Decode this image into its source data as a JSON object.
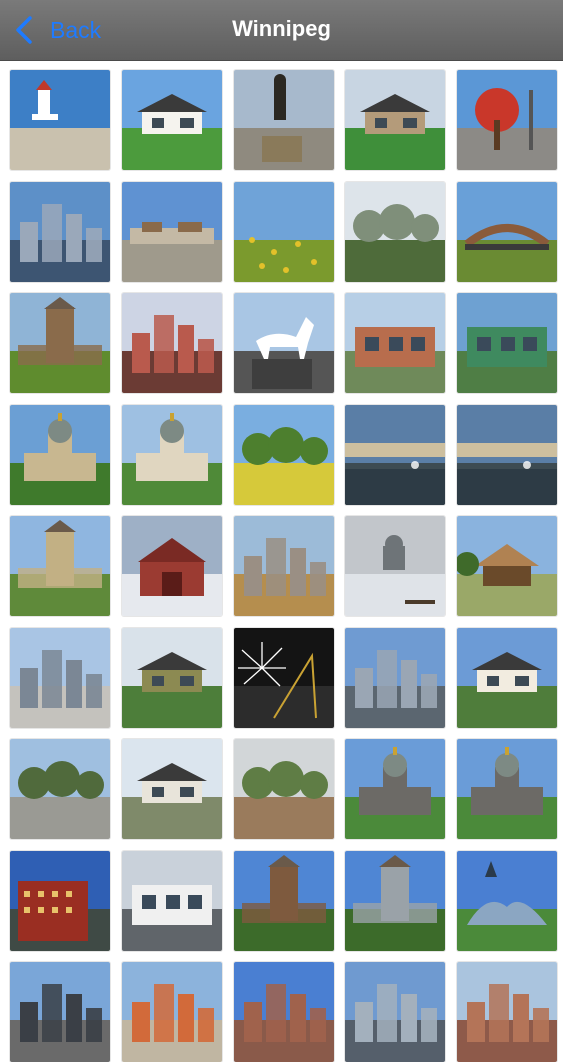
{
  "navbar": {
    "back_label": "Back",
    "title": "Winnipeg",
    "accent": "#1e7bff"
  },
  "gallery": {
    "columns": 5,
    "tiles": [
      {
        "sky": "#3d7fc6",
        "ground": "#c9c1ae",
        "accent": "#ffffff",
        "kind": "lighthouse"
      },
      {
        "sky": "#6aa4e0",
        "ground": "#4c9b3d",
        "accent": "#f5f3ee",
        "kind": "house"
      },
      {
        "sky": "#a7b9cc",
        "ground": "#8f8a7f",
        "accent": "#2b2822",
        "kind": "statue"
      },
      {
        "sky": "#c8d5e2",
        "ground": "#3f8f3a",
        "accent": "#b49b7a",
        "kind": "house"
      },
      {
        "sky": "#5b97d6",
        "ground": "#8c8a86",
        "accent": "#c9372a",
        "kind": "tree"
      },
      {
        "sky": "#5d90c8",
        "ground": "#3d5572",
        "accent": "#9aa8ba",
        "kind": "city"
      },
      {
        "sky": "#5f92d2",
        "ground": "#9f9a8c",
        "accent": "#c4b9a5",
        "kind": "plaza"
      },
      {
        "sky": "#6fa3d8",
        "ground": "#7b9a2d",
        "accent": "#e3c12a",
        "kind": "field"
      },
      {
        "sky": "#dde4ea",
        "ground": "#4e6b3a",
        "accent": "#7f8f7a",
        "kind": "park"
      },
      {
        "sky": "#69a0d8",
        "ground": "#6a8b33",
        "accent": "#8a5b3b",
        "kind": "bridge"
      },
      {
        "sky": "#8fb4d6",
        "ground": "#5f8c2e",
        "accent": "#8a6b4b",
        "kind": "castle"
      },
      {
        "sky": "#cdd4e4",
        "ground": "#6b3b34",
        "accent": "#b95a4d",
        "kind": "city"
      },
      {
        "sky": "#a9c6e4",
        "ground": "#555555",
        "accent": "#ffffff",
        "kind": "horse"
      },
      {
        "sky": "#b7cfe6",
        "ground": "#6f8a5a",
        "accent": "#b86d4d",
        "kind": "building"
      },
      {
        "sky": "#6ea1d2",
        "ground": "#4f7e45",
        "accent": "#3f8a5f",
        "kind": "building"
      },
      {
        "sky": "#6b9fd4",
        "ground": "#3f7a2c",
        "accent": "#c8b790",
        "kind": "dome"
      },
      {
        "sky": "#9ec0e2",
        "ground": "#4f8a38",
        "accent": "#e0d6c0",
        "kind": "dome"
      },
      {
        "sky": "#7aaee0",
        "ground": "#d6c93a",
        "accent": "#4d7f2e",
        "kind": "park"
      },
      {
        "sky": "#5a7ea6",
        "ground": "#3d4b52",
        "accent": "#cdbf9f",
        "kind": "lake"
      },
      {
        "sky": "#5a7ea6",
        "ground": "#3d4b52",
        "accent": "#cdbf9f",
        "kind": "lake"
      },
      {
        "sky": "#8fb6e0",
        "ground": "#5f8a3a",
        "accent": "#c2b084",
        "kind": "castle"
      },
      {
        "sky": "#9eb0c6",
        "ground": "#e6e9ee",
        "accent": "#9b3b32",
        "kind": "barn"
      },
      {
        "sky": "#9cbbd8",
        "ground": "#b58e4e",
        "accent": "#9a8f84",
        "kind": "city"
      },
      {
        "sky": "#c2c6cb",
        "ground": "#dfe3e8",
        "accent": "#6e7478",
        "kind": "snow"
      },
      {
        "sky": "#8ab3de",
        "ground": "#9aa868",
        "accent": "#b08252",
        "kind": "pavilion"
      },
      {
        "sky": "#a9c5e4",
        "ground": "#c4c2bd",
        "accent": "#7b8795",
        "kind": "city"
      },
      {
        "sky": "#d9e2ea",
        "ground": "#4d7e3a",
        "accent": "#8c8a52",
        "kind": "house"
      },
      {
        "sky": "#141414",
        "ground": "#2c2c2c",
        "accent": "#ffffff",
        "kind": "fireworks"
      },
      {
        "sky": "#6f9bd2",
        "ground": "#5b6670",
        "accent": "#9aa6b4",
        "kind": "city"
      },
      {
        "sky": "#6c9bd6",
        "ground": "#4f7d3b",
        "accent": "#f2ece0",
        "kind": "house"
      },
      {
        "sky": "#9fbfe0",
        "ground": "#9a9a94",
        "accent": "#506a3c",
        "kind": "park"
      },
      {
        "sky": "#dbe5ee",
        "ground": "#7f8a6a",
        "accent": "#e8e4da",
        "kind": "house"
      },
      {
        "sky": "#d2d6d8",
        "ground": "#9a7b5c",
        "accent": "#5f7d45",
        "kind": "park"
      },
      {
        "sky": "#6a9cd8",
        "ground": "#4b8a3a",
        "accent": "#6c6a66",
        "kind": "dome"
      },
      {
        "sky": "#6a9cd8",
        "ground": "#4b8a3a",
        "accent": "#6c6a66",
        "kind": "dome"
      },
      {
        "sky": "#2f5fb4",
        "ground": "#3f4a45",
        "accent": "#9a2e22",
        "kind": "hotel"
      },
      {
        "sky": "#c9d1da",
        "ground": "#60656a",
        "accent": "#f0f0f0",
        "kind": "building"
      },
      {
        "sky": "#4f86d4",
        "ground": "#3c6b2a",
        "accent": "#7e5a3e",
        "kind": "castle"
      },
      {
        "sky": "#4f86d4",
        "ground": "#3c6b2a",
        "accent": "#9aa2a8",
        "kind": "castle"
      },
      {
        "sky": "#4a7fd2",
        "ground": "#4b8a3a",
        "accent": "#8ba6c2",
        "kind": "museum"
      },
      {
        "sky": "#7aa6d8",
        "ground": "#6a6a6a",
        "accent": "#3a3f46",
        "kind": "city"
      },
      {
        "sky": "#8cb3dc",
        "ground": "#c0b6a2",
        "accent": "#d26a3a",
        "kind": "city"
      },
      {
        "sky": "#4a7fd2",
        "ground": "#8a5a4a",
        "accent": "#a0624c",
        "kind": "city"
      },
      {
        "sky": "#6f9ad0",
        "ground": "#555f6b",
        "accent": "#a3b0bd",
        "kind": "city"
      },
      {
        "sky": "#aac4de",
        "ground": "#8e5a4a",
        "accent": "#b47458",
        "kind": "city"
      }
    ]
  }
}
